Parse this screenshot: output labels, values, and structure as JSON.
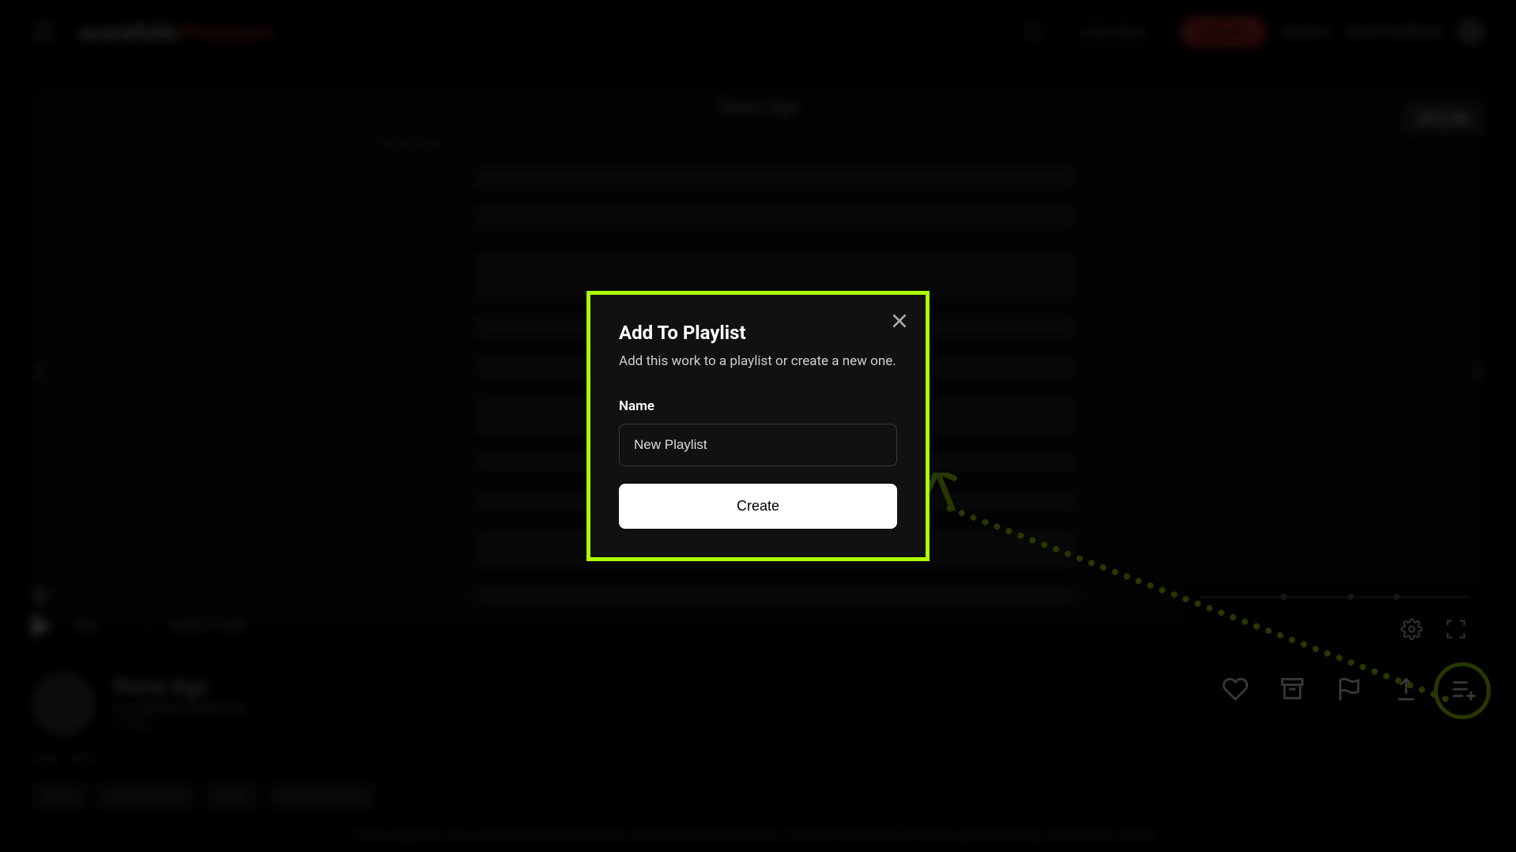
{
  "accent_highlight": "#aeff00",
  "header": {
    "logo_main": "scorefolio",
    "logo_suffix": "Premium",
    "new_work_label": "+ New Work",
    "upgrade_label": "Upgrade",
    "nav_browse": "Explore",
    "nav_feedback": "Send Feedback"
  },
  "sheet": {
    "title": "Stone Age",
    "subtitle_left": "Charly Walter",
    "cart_price": "$12.99",
    "nav_prev_glyph": "‹",
    "nav_next_glyph": "›"
  },
  "playback": {
    "position": "0:00",
    "duration": "3:46",
    "rate_30x": "30x",
    "chev_left": "‹",
    "chev_right": "›"
  },
  "piece": {
    "title": "Stone Age",
    "author": "scorefolio featured",
    "likes": "18 likes",
    "tab_view": "View",
    "tab_info": "Info",
    "tags": [
      "Easy",
      "Intermediate",
      "Solo",
      "Modern Piano"
    ],
    "description": "Stone Age for solo and ensemble has been commissioned by Music Council Festival 2024 to be performed by artists like on this."
  },
  "mini_player": {
    "settings_name": "gear-icon",
    "fullscreen_name": "fullscreen-icon"
  },
  "actions": {
    "like_name": "heart-icon",
    "save_name": "archive-icon",
    "report_name": "flag-icon",
    "share_name": "share-icon",
    "playlist_name": "playlist-add-icon"
  },
  "modal": {
    "title": "Add To Playlist",
    "subtitle": "Add this work to a playlist or create a new one.",
    "field_label": "Name",
    "field_value": "New Playlist",
    "button_label": "Create"
  }
}
